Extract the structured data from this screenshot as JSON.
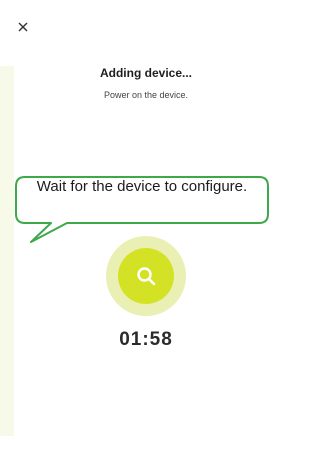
{
  "header": {
    "close_icon": "close-icon"
  },
  "main": {
    "title": "Adding device...",
    "subtitle": "Power on the device.",
    "callout_text": "Wait for the device to configure.",
    "search_icon": "search-icon",
    "timer": "01:58"
  },
  "colors": {
    "accent": "#d4e226",
    "accent_light": "#eaf0b4",
    "callout_border": "#3ea84a",
    "side_panel": "#f7fae9"
  }
}
